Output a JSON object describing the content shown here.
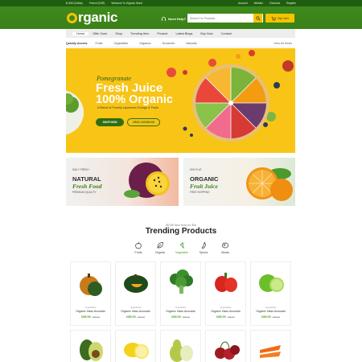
{
  "topbar": {
    "currency": "$ USD (Dollar)",
    "language": "French (EUR)",
    "welcome": "Welcome To Organic Store!",
    "account": "Account",
    "wishlist": "Wishlist",
    "checkout": "Checkout",
    "register": "Register"
  },
  "header": {
    "logo_text": "rganic",
    "help": "Need Help?",
    "search_placeholder": "Search For Products...",
    "cart_label": "My Cart"
  },
  "nav": {
    "items": [
      "Home",
      "Offer Zone",
      "Shop",
      "Trending Item",
      "Product",
      "Latest Blogs",
      "Buy Now",
      "Contact"
    ]
  },
  "quick_access": {
    "label": "Quickly Access",
    "chips": [
      "Fruits",
      "Vegetables",
      "Organics",
      "Groceries",
      "Naturals"
    ],
    "all": "View All Deals"
  },
  "hero": {
    "subtitle": "Pomegranate",
    "title_1": "Fresh Juice",
    "title_2": "100% Organic",
    "description": "A Blend of Freshly squeezed Orange & Fruits",
    "btn_shop": "SHOP NOW",
    "btn_view": "VIEW LOOKBOOK"
  },
  "promos": [
    {
      "small": "DAILY FRESH",
      "line1": "NATURAL",
      "line2": "Fresh Food",
      "note": "PREMIUM QUALITY"
    },
    {
      "small": "30% FLAT",
      "line1": "ORGANIC",
      "line2": "Fruit Juice",
      "note": "FREE SHIPPING"
    }
  ],
  "trending": {
    "subtitle": "All the best item for You",
    "title": "Trending Products",
    "categories": [
      "Fruits",
      "Organic",
      "Vegetable",
      "Spices",
      "Meats"
    ],
    "active": "Vegetable"
  },
  "products": [
    {
      "category": "Vegetables",
      "name": "Organic Hass Avocado",
      "price": "£85.00",
      "old": "£95.00"
    },
    {
      "category": "Vegetables",
      "name": "Organic Hass Avocado",
      "price": "£85.00",
      "old": "£95.00"
    },
    {
      "category": "Vegetables",
      "name": "Organic Hass Avocado",
      "price": "£85.00",
      "old": "£95.00"
    },
    {
      "category": "Vegetables",
      "name": "Organic Hass Avocado",
      "price": "£85.00",
      "old": "£95.00"
    },
    {
      "category": "Vegetables",
      "name": "Organic Hass Avocado",
      "price": "£85.00",
      "old": "£95.00"
    }
  ],
  "colors": {
    "primary_green": "#3f8a1c",
    "dark_green": "#1f5e10",
    "accent_yellow": "#f5c400",
    "price_green": "#4a9b1e"
  }
}
